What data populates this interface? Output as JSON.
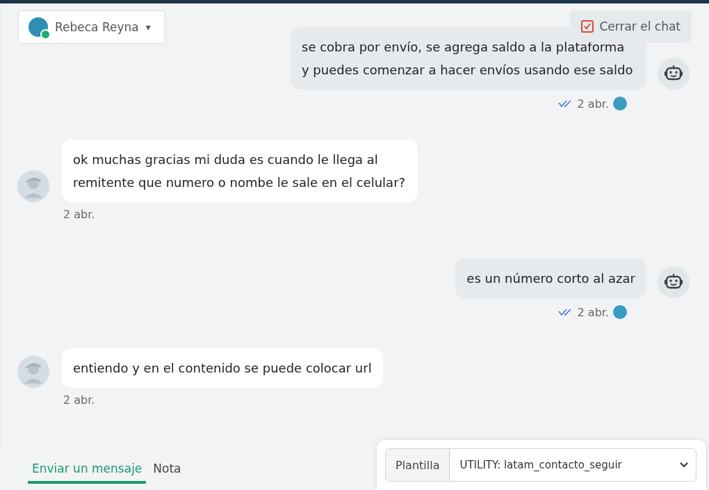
{
  "contact": {
    "name": "Rebeca Reyna",
    "caret": "▾",
    "online": true
  },
  "close_chat": {
    "label": "Cerrar el chat",
    "checked": true
  },
  "messages": [
    {
      "kind": "outgoing",
      "text": "se cobra por envío, se agrega saldo a la plataforma y puedes comenzar a hacer envíos usando ese saldo",
      "time": "2 abr.",
      "read": true
    },
    {
      "kind": "incoming",
      "text": "ok muchas gracias mi duda es cuando le llega al remitente que numero o nombe le sale en el celular?",
      "time": "2 abr."
    },
    {
      "kind": "outgoing",
      "text": "es un número corto al azar",
      "time": "2 abr.",
      "read": true
    },
    {
      "kind": "incoming",
      "text": "entiendo y en el contenido se puede colocar url",
      "time": "2 abr."
    }
  ],
  "composer_tabs": [
    {
      "label": "Enviar un mensaje",
      "selected": true
    },
    {
      "label": "Nota",
      "selected": false
    }
  ],
  "template": {
    "label": "Plantilla",
    "value": "UTILITY: latam_contacto_seguir"
  }
}
